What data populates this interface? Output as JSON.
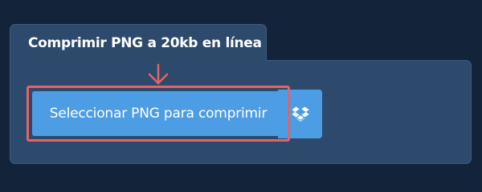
{
  "tab": {
    "title": "Comprimir PNG a 20kb en línea"
  },
  "upload": {
    "select_label": "Seleccionar PNG para comprimir",
    "dropbox_icon": "dropbox-icon"
  },
  "annotation": {
    "arrow_icon": "arrow-down-icon",
    "highlight_color": "#e56364"
  },
  "colors": {
    "background": "#12233a",
    "panel": "#2d4a6c",
    "button": "#4d9de5",
    "text": "#ffffff"
  }
}
